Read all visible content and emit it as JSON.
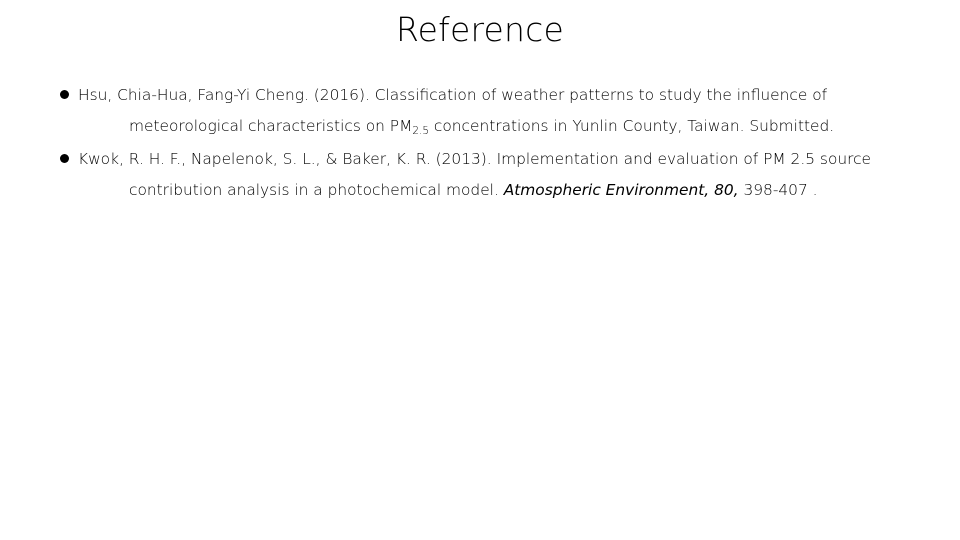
{
  "slide": {
    "title": "Reference",
    "background_color": "#ffffff",
    "text_color": "#000000"
  },
  "references": [
    {
      "bullet": "filled-circle-bullet",
      "lines": [
        {
          "segments": [
            {
              "text": "Hsu, Chia-Hua, Fang-Yi Cheng. (2016). Classification of weather patterns to study the influence of",
              "style": "normal"
            }
          ]
        },
        {
          "indent": true,
          "segments": [
            {
              "text": "meteorological characteristics on PM",
              "style": "normal"
            },
            {
              "text": "2.5",
              "style": "subscript"
            },
            {
              "text": " concentrations in Yunlin County, Taiwan. Submitted.",
              "style": "normal"
            }
          ]
        }
      ]
    },
    {
      "bullet": "filled-circle-bullet",
      "lines": [
        {
          "segments": [
            {
              "text": "Kwok, R. H. F., Napelenok, S. L., & Baker, K. R. (2013). Implementation and evaluation of PM 2.5 source",
              "style": "normal"
            }
          ]
        },
        {
          "indent": true,
          "segments": [
            {
              "text": "contribution analysis in a photochemical model. ",
              "style": "normal"
            },
            {
              "text": "Atmospheric Environment, 80,",
              "style": "italic"
            },
            {
              "text": " 398-407 .",
              "style": "normal"
            }
          ]
        }
      ]
    }
  ]
}
